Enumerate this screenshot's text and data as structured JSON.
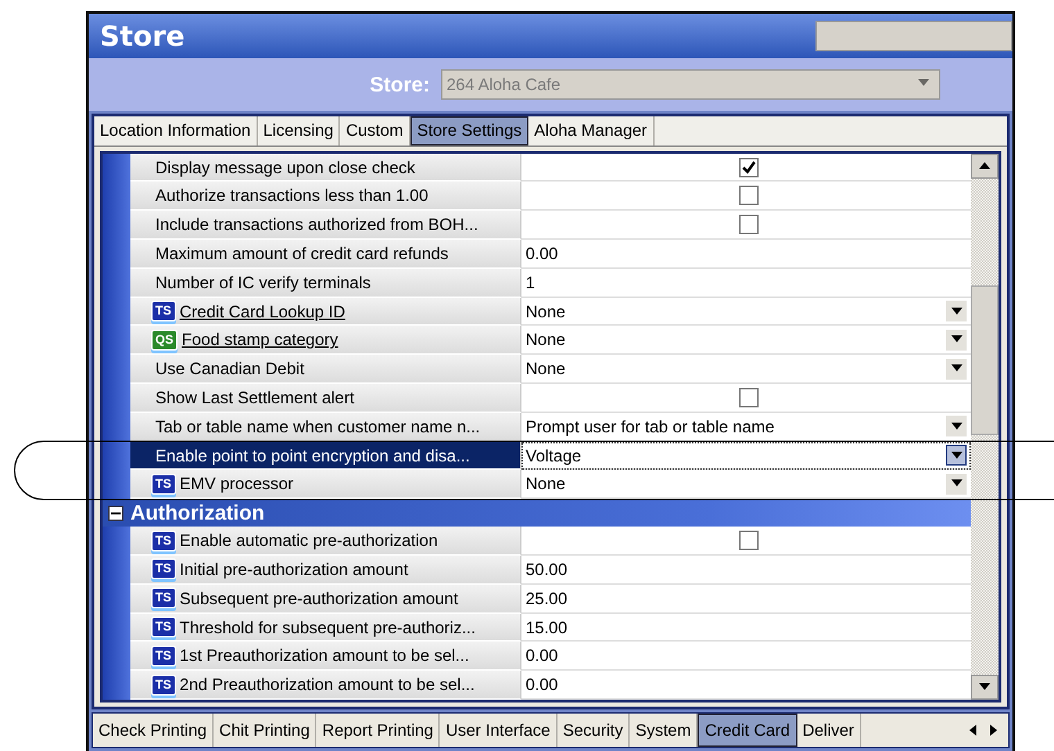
{
  "window": {
    "title": "Store"
  },
  "store_selector": {
    "label": "Store:",
    "value": "264 Aloha Cafe",
    "disabled": true
  },
  "tabs": [
    {
      "label": "Location Information",
      "selected": false
    },
    {
      "label": "Licensing",
      "selected": false
    },
    {
      "label": "Custom",
      "selected": false
    },
    {
      "label": "Store Settings",
      "selected": true
    },
    {
      "label": "Aloha Manager",
      "selected": false
    }
  ],
  "properties": {
    "rows": [
      {
        "label": "Display message upon close check",
        "kind": "checkbox",
        "checked": true,
        "selected": false
      },
      {
        "label": "Authorize transactions less than 1.00",
        "kind": "checkbox",
        "checked": false,
        "selected": false
      },
      {
        "label": "Include transactions authorized from BOH...",
        "kind": "checkbox",
        "checked": false,
        "selected": false
      },
      {
        "label": "Maximum amount of credit card refunds",
        "kind": "text",
        "value": "0.00",
        "selected": false
      },
      {
        "label": "Number of IC verify terminals",
        "kind": "text",
        "value": "1",
        "selected": false
      },
      {
        "label": "Credit Card Lookup ID",
        "kind": "dropdown",
        "value": "None",
        "icon_text": "TS",
        "color": "#1b2fa8",
        "link": true,
        "selected": false
      },
      {
        "label": "Food stamp category",
        "kind": "dropdown",
        "value": "None",
        "icon_text": "QS",
        "color": "#2a8a2a",
        "link": true,
        "selected": false
      },
      {
        "label": "Use Canadian Debit",
        "kind": "dropdown",
        "value": "None",
        "selected": false
      },
      {
        "label": "Show Last Settlement alert",
        "kind": "checkbox",
        "checked": false,
        "selected": false
      },
      {
        "label": "Tab or table name when customer name n...",
        "kind": "dropdown",
        "value": "Prompt user for tab or table name",
        "selected": false
      },
      {
        "label": "Enable point to point encryption and disa...",
        "kind": "dropdown",
        "value": "Voltage",
        "selected": true
      },
      {
        "label": "EMV processor",
        "kind": "dropdown",
        "value": "None",
        "icon_text": "TS",
        "color": "#1b2fa8",
        "selected": false
      }
    ],
    "sections": [
      {
        "title": "Authorization",
        "expanded": true,
        "rows": [
          {
            "label": "Enable automatic pre-authorization",
            "kind": "checkbox",
            "checked": false,
            "icon_text": "TS",
            "color": "#1b2fa8",
            "selected": false
          },
          {
            "label": "Initial pre-authorization amount",
            "kind": "text",
            "value": "50.00",
            "icon_text": "TS",
            "color": "#1b2fa8",
            "selected": false
          },
          {
            "label": "Subsequent pre-authorization amount",
            "kind": "text",
            "value": "25.00",
            "icon_text": "TS",
            "color": "#1b2fa8",
            "selected": false
          },
          {
            "label": "Threshold for subsequent pre-authoriz...",
            "kind": "text",
            "value": "15.00",
            "icon_text": "TS",
            "color": "#1b2fa8",
            "selected": false
          },
          {
            "label": "1st Preauthorization amount to be sel...",
            "kind": "text",
            "value": "0.00",
            "icon_text": "TS",
            "color": "#1b2fa8",
            "selected": false
          },
          {
            "label": "2nd Preauthorization amount to be sel...",
            "kind": "text",
            "value": "0.00",
            "icon_text": "TS",
            "color": "#1b2fa8",
            "selected": false
          }
        ]
      }
    ]
  },
  "bottom_tabs": [
    {
      "label": "Check Printing",
      "selected": false
    },
    {
      "label": "Chit Printing",
      "selected": false
    },
    {
      "label": "Report Printing",
      "selected": false
    },
    {
      "label": "User Interface",
      "selected": false
    },
    {
      "label": "Security",
      "selected": false
    },
    {
      "label": "System",
      "selected": false
    },
    {
      "label": "Credit Card",
      "selected": true
    },
    {
      "label": "Deliver",
      "selected": false
    }
  ]
}
